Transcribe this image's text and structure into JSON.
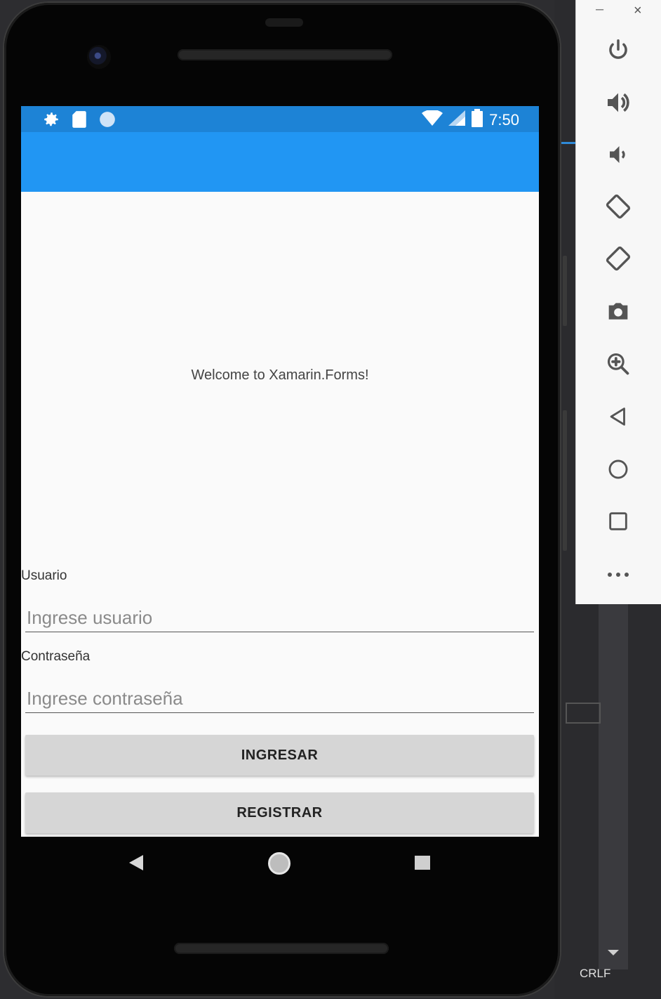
{
  "status_bar": {
    "time": "7:50"
  },
  "app": {
    "welcome_text": "Welcome to Xamarin.Forms!",
    "user_label": "Usuario",
    "user_placeholder": "Ingrese usuario",
    "password_label": "Contraseña",
    "password_placeholder": "Ingrese contraseña",
    "login_button": "INGRESAR",
    "register_button": "REGISTRAR"
  },
  "emulator_panel": {
    "minimize_label": "–",
    "close_label": "×",
    "buttons": [
      "power-icon",
      "volume-up-icon",
      "volume-down-icon",
      "rotate-left-icon",
      "rotate-right-icon",
      "camera-icon",
      "zoom-icon",
      "back-icon",
      "home-icon",
      "overview-icon",
      "more-icon"
    ]
  },
  "ide": {
    "line_ending": "CRLF"
  },
  "colors": {
    "status_bar": "#1d83d6",
    "toolbar": "#2196f3",
    "button_bg": "#d6d6d6",
    "screen_bg": "#fafafa"
  }
}
